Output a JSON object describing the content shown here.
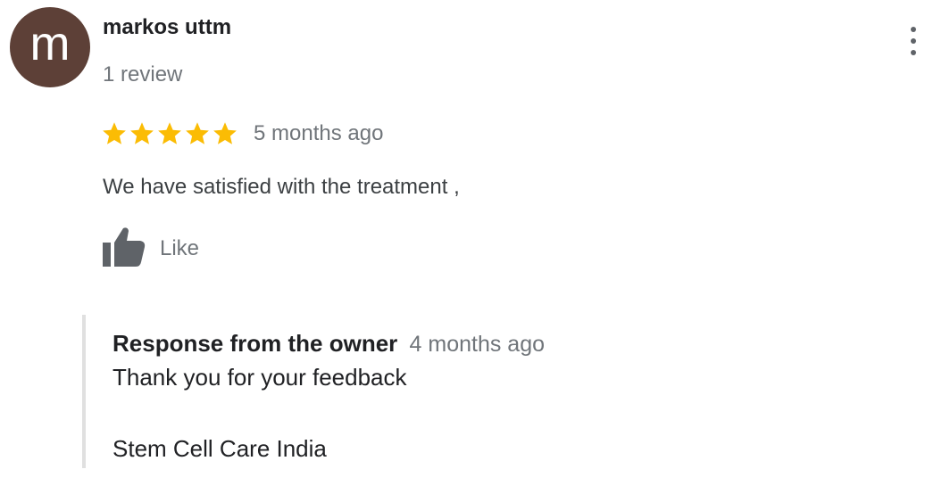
{
  "review": {
    "avatar_letter": "m",
    "avatar_color": "#5d4037",
    "reviewer_name": "markos uttm",
    "review_count": "1 review",
    "rating": 5,
    "max_rating": 5,
    "star_color": "#fbbc04",
    "time_ago": "5 months ago",
    "text": "We have satisfied with the treatment ,",
    "like_label": "Like",
    "more_icon": "more-vert-icon"
  },
  "owner_response": {
    "title": "Response from the owner",
    "time_ago": "4 months ago",
    "message_line1": "Thank you for your feedback",
    "message_line2": "Stem Cell Care India"
  }
}
